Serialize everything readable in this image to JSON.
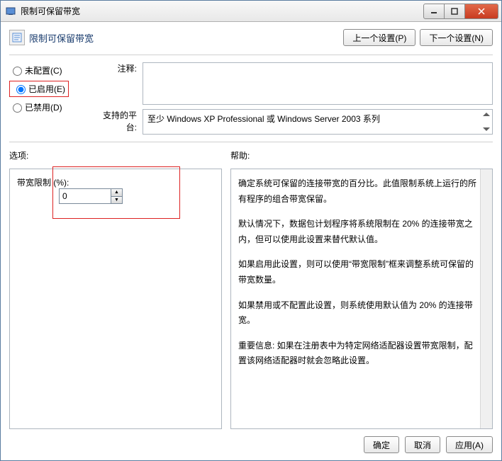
{
  "titlebar": {
    "title": "限制可保留带宽"
  },
  "header": {
    "title": "限制可保留带宽",
    "prev_btn": "上一个设置(P)",
    "next_btn": "下一个设置(N)"
  },
  "radios": {
    "not_configured": "未配置(C)",
    "enabled": "已启用(E)",
    "disabled": "已禁用(D)"
  },
  "meta": {
    "comment_label": "注释:",
    "comment_value": "",
    "platform_label": "支持的平台:",
    "platform_value": "至少 Windows XP Professional 或 Windows Server 2003 系列"
  },
  "options": {
    "pane_label": "选项:",
    "bandwidth_label": "带宽限制 (%):",
    "bandwidth_value": "0"
  },
  "help": {
    "pane_label": "帮助:",
    "p1": "确定系统可保留的连接带宽的百分比。此值限制系统上运行的所有程序的组合带宽保留。",
    "p2": "默认情况下，数据包计划程序将系统限制在 20% 的连接带宽之内，但可以使用此设置来替代默认值。",
    "p3": "如果启用此设置，则可以使用“带宽限制”框来调整系统可保留的带宽数量。",
    "p4": "如果禁用或不配置此设置，则系统使用默认值为 20% 的连接带宽。",
    "p5": "重要信息: 如果在注册表中为特定网络适配器设置带宽限制，配置该网络适配器时就会忽略此设置。"
  },
  "footer": {
    "ok": "确定",
    "cancel": "取消",
    "apply": "应用(A)"
  }
}
